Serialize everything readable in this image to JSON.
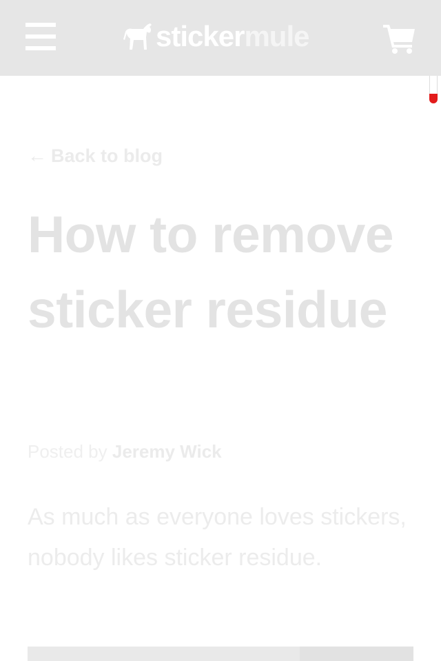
{
  "header": {
    "logo_sticker": "sticker",
    "logo_mule": "mule",
    "background": "#e6e6e6"
  },
  "icons": {
    "menu": "hamburger-menu-icon",
    "logo": "mule-logo-icon",
    "cart": "shopping-cart-icon",
    "back": "left-arrow-icon"
  },
  "nav": {
    "back_arrow": "←",
    "back_label": "Back to blog"
  },
  "article": {
    "title": "How to remove sticker residue",
    "byline_prefix": "Posted by",
    "author": "Jeremy Wick",
    "intro": "As much as everyone loves stickers, nobody likes sticker residue."
  },
  "colors": {
    "accent": "#e21b1b",
    "text_faded": "#e3e3e3"
  }
}
